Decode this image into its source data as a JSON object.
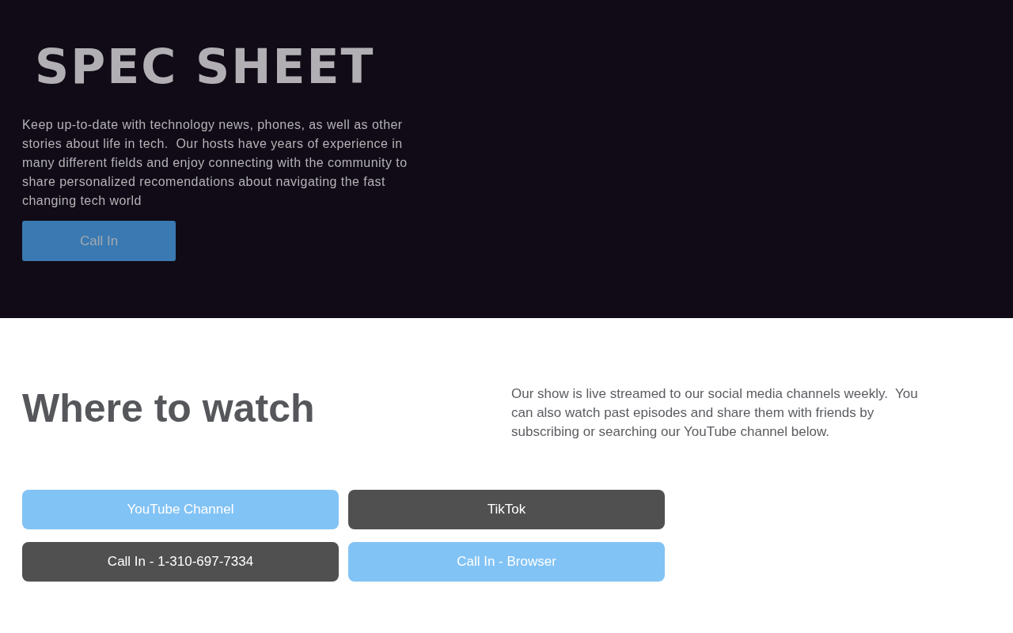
{
  "hero": {
    "logo": "SPEC SHEET",
    "description": "Keep up-to-date with technology news, phones, as well as other stories about life in tech.  Our hosts have years of experience in many different fields and enjoy connecting with the community to share personalized recomendations about navigating the fast changing tech world",
    "button": "Call In"
  },
  "watch": {
    "heading": "Where to watch",
    "description": "Our show is live streamed to our social media channels weekly.  You can also watch past episodes and share them with friends by subscribing or searching our YouTube channel below.",
    "links": [
      {
        "label": "YouTube Channel",
        "kind": "light"
      },
      {
        "label": "TikTok",
        "kind": "dark"
      },
      {
        "label": "Call In - 1-310-697-7334",
        "kind": "dark"
      },
      {
        "label": "Call In - Browser",
        "kind": "light"
      }
    ]
  }
}
